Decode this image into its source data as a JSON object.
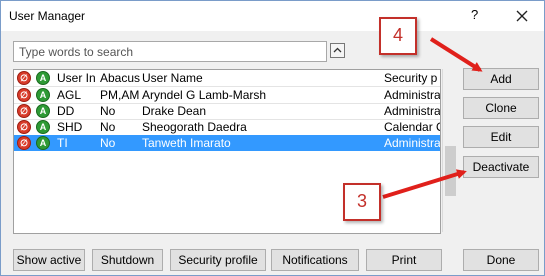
{
  "window": {
    "title": "User Manager",
    "help_label": "?"
  },
  "search": {
    "placeholder": "Type words to search"
  },
  "table": {
    "columns": [
      "User In",
      "Abacus",
      "User Name",
      "Security p"
    ],
    "rows": [
      {
        "user": "AGL",
        "abacus": "PM,AM",
        "name": "Aryndel G Lamb-Marsh",
        "security": "Administra",
        "selected": false
      },
      {
        "user": "DD",
        "abacus": "No",
        "name": "Drake Dean",
        "security": "Administra",
        "selected": false
      },
      {
        "user": "SHD",
        "abacus": "No",
        "name": "Sheogorath Daedra",
        "security": "Calendar O",
        "selected": false
      },
      {
        "user": "TI",
        "abacus": "No",
        "name": "Tanweth Imarato",
        "security": "Administra",
        "selected": true
      }
    ]
  },
  "side_buttons": {
    "add": "Add",
    "clone": "Clone",
    "edit": "Edit",
    "deactivate": "Deactivate"
  },
  "bottom_buttons": {
    "show_active": "Show active",
    "shutdown": "Shutdown",
    "security_profile": "Security profile",
    "notifications": "Notifications",
    "print": "Print",
    "done": "Done"
  },
  "annotations": {
    "callout_add": "4",
    "callout_deactivate": "3",
    "color": "#e0201b"
  },
  "colors": {
    "selection": "#3399ff",
    "icon_red": "#d83b2a",
    "icon_green": "#2e9a35"
  }
}
